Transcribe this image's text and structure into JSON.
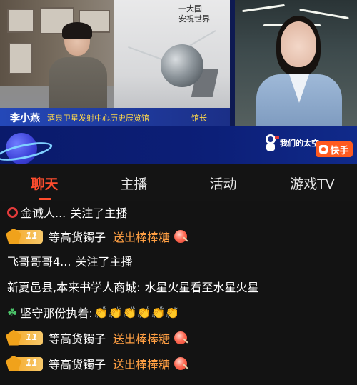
{
  "video": {
    "caption": {
      "name": "李小燕",
      "title": "酒泉卫星发射中心历史展览馆",
      "role": "馆长"
    },
    "showcase_text": "一大国\n安祝世界\n…",
    "program_logo": "我们的太空",
    "app_badge": "快手"
  },
  "tabs": [
    {
      "label": "聊天",
      "active": true
    },
    {
      "label": "主播",
      "active": false
    },
    {
      "label": "活动",
      "active": false
    },
    {
      "label": "游戏TV",
      "active": false
    }
  ],
  "chat": [
    {
      "type": "follow",
      "icon": "red-circle-icon",
      "user": "金诚人...",
      "text": "关注了主播"
    },
    {
      "type": "gift",
      "level": "11",
      "user": "等高货镯子",
      "text": "送出棒棒糖"
    },
    {
      "type": "follow",
      "user": "飞哥哥哥4...",
      "text": "关注了主播"
    },
    {
      "type": "comment",
      "user": "新夏邑县,本来书学人商城:",
      "text": "水星火星看至水星火星"
    },
    {
      "type": "comment",
      "icon": "clover-icon",
      "user": "坚守那份执着:",
      "text": "👏👏👏👏👏👏"
    },
    {
      "type": "gift",
      "level": "11",
      "user": "等高货镯子",
      "text": "送出棒棒糖"
    },
    {
      "type": "gift",
      "level": "11",
      "user": "等高货镯子",
      "text": "送出棒棒糖"
    }
  ],
  "colors": {
    "accent": "#ff4d2e",
    "gift_text": "#ff9f43",
    "background": "#131313"
  }
}
